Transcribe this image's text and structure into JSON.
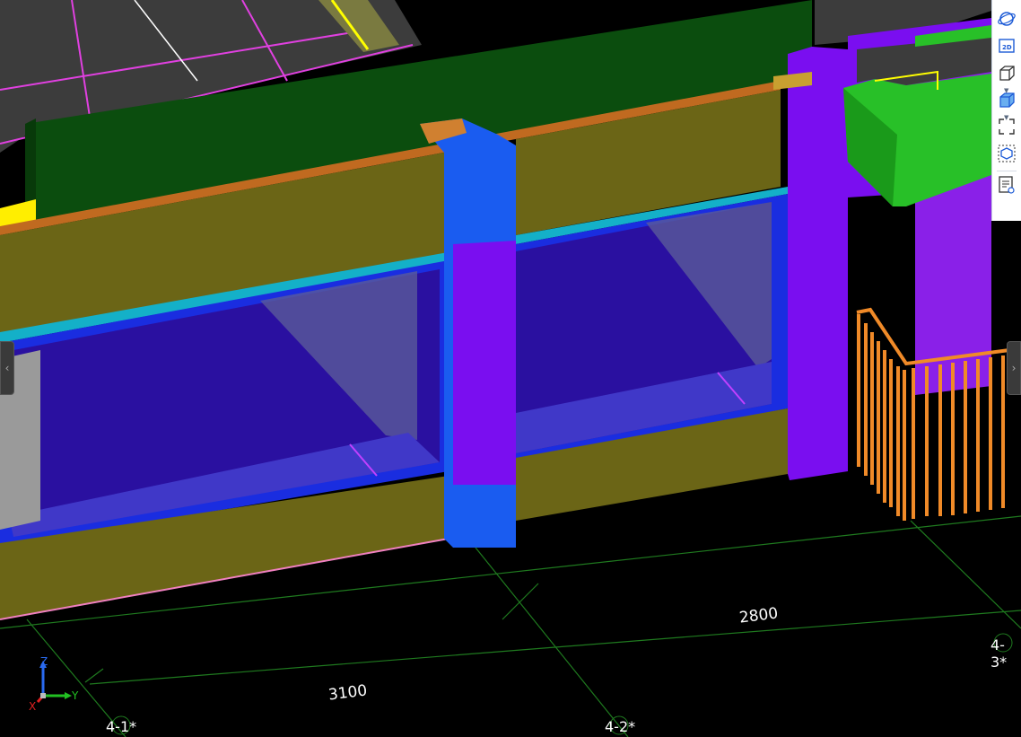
{
  "view": {
    "dimensions": [
      "3100",
      "2800"
    ],
    "grid_axes": [
      "4-1*",
      "4-2*",
      "4-3*"
    ]
  },
  "triad": {
    "x_label": "X",
    "y_label": "Y",
    "z_label": "Z"
  },
  "toolbar": {
    "items": [
      {
        "icon": "orbit-icon"
      },
      {
        "icon": "2d-view-icon",
        "label": "2D"
      },
      {
        "icon": "view-cube-icon"
      },
      {
        "icon": "shaded-box-icon"
      },
      {
        "icon": "fit-view-icon"
      },
      {
        "icon": "section-box-icon"
      },
      {
        "icon": "properties-view-icon"
      }
    ]
  },
  "colors": {
    "background": "#000000",
    "beam_olive": "#6b6516",
    "column_purple": "#7a0ef0",
    "column_blue": "#1a5cf0",
    "glass": "#2a10a0",
    "green_wall": "#0b4d0e",
    "railing": "#f08a28",
    "grid_line": "#1f7a1f"
  }
}
